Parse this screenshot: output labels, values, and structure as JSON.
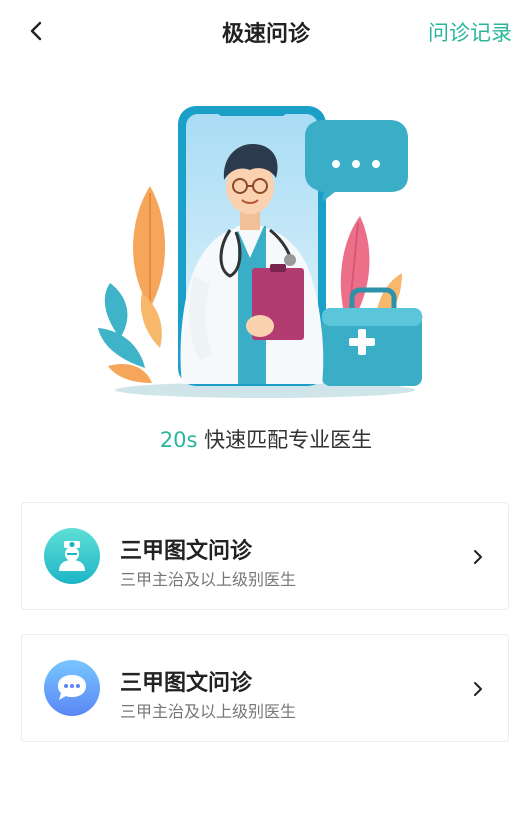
{
  "header": {
    "title": "极速问诊",
    "right_link": "问诊记录"
  },
  "hero": {
    "tagline_accent": "20s",
    "tagline_text": " 快速匹配专业医生"
  },
  "options": [
    {
      "title": "三甲图文问诊",
      "subtitle": "三甲主治及以上级别医生",
      "icon": "doctor-avatar-icon"
    },
    {
      "title": "三甲图文问诊",
      "subtitle": "三甲主治及以上级别医生",
      "icon": "chat-bubble-icon"
    }
  ],
  "colors": {
    "accent": "#2bb59b",
    "card1_icon": "#1cb5c7",
    "card2_icon": "#5a87f5"
  }
}
